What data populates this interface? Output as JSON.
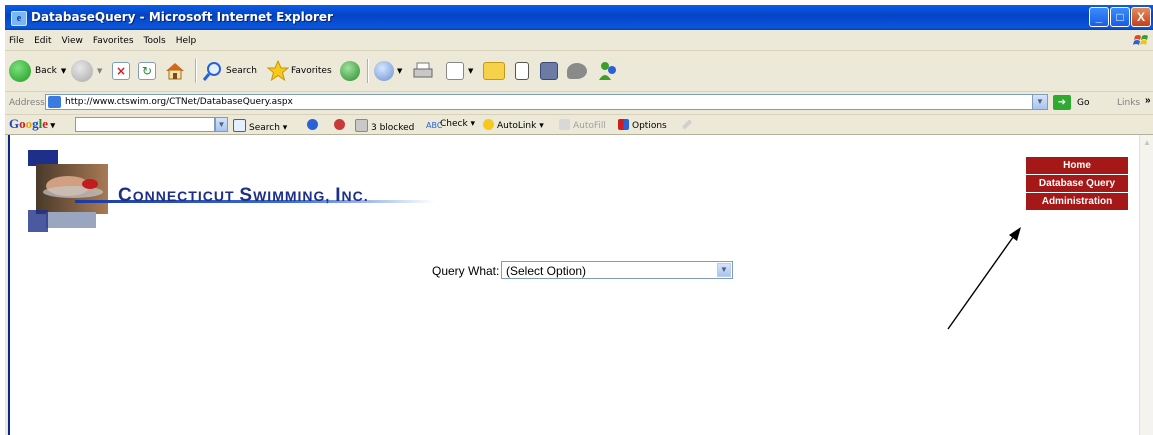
{
  "window": {
    "title": "DatabaseQuery - Microsoft Internet Explorer",
    "buttons": {
      "minimize": "_",
      "maximize": "□",
      "close": "X"
    }
  },
  "menu": [
    "File",
    "Edit",
    "View",
    "Favorites",
    "Tools",
    "Help"
  ],
  "toolbar": {
    "back_label": "Back",
    "search_label": "Search",
    "favorites_label": "Favorites"
  },
  "address": {
    "label": "Address",
    "url": "http://www.ctswim.org/CTNet/DatabaseQuery.aspx",
    "go_label": "Go",
    "links_label": "Links"
  },
  "google_toolbar": {
    "logo": "Google",
    "search_label": "Search",
    "blocked_label": "3 blocked",
    "check_label": "Check",
    "autolink_label": "AutoLink",
    "autofill_label": "AutoFill",
    "options_label": "Options"
  },
  "site": {
    "logo_text_part1": "C",
    "logo_text_part2": "ONNECTICUT ",
    "logo_text_part3": "S",
    "logo_text_part4": "WIMMING, ",
    "logo_text_part5": "I",
    "logo_text_part6": "NC.",
    "nav": [
      "Home",
      "Database Query",
      "Administration"
    ],
    "query_label": "Query What:",
    "query_value": "(Select Option)"
  },
  "colors": {
    "nav_bg": "#a51818",
    "titlebar": "#0a5ee8",
    "logo_text": "#1e2f8a"
  }
}
